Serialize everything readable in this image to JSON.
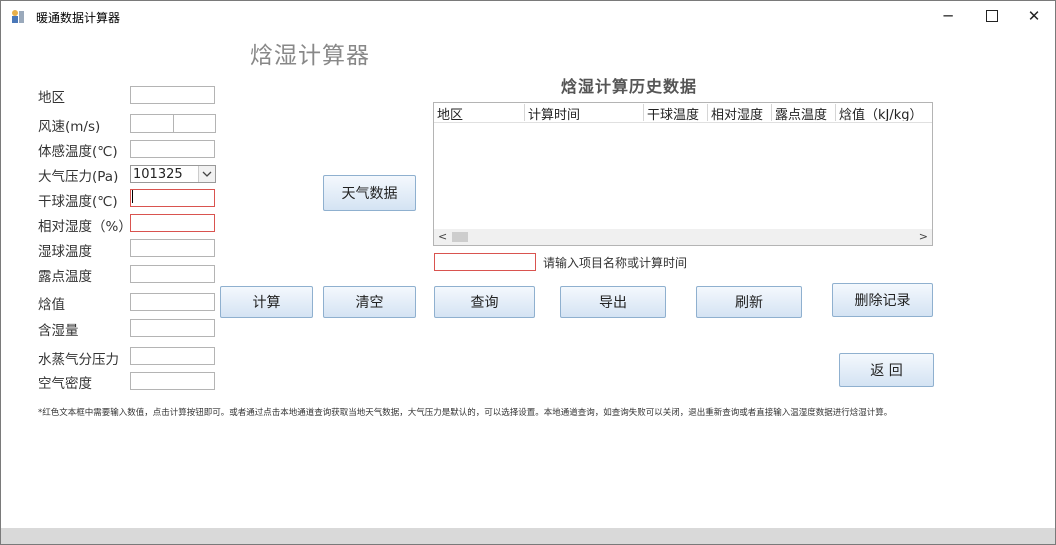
{
  "window": {
    "title": "暖通数据计算器",
    "controls": {
      "minimize": "─",
      "close": "✕"
    }
  },
  "main": {
    "heading": "焓湿计算器",
    "fields": {
      "region": {
        "label": "地区",
        "value": ""
      },
      "wind_speed": {
        "label": "风速(m/s)",
        "value": ""
      },
      "feels_like": {
        "label": "体感温度(℃)",
        "value": ""
      },
      "pressure": {
        "label": "大气压力(Pa)",
        "value": "101325"
      },
      "dry_bulb": {
        "label": "干球温度(℃)",
        "value": ""
      },
      "rel_humidity": {
        "label": "相对湿度（%）",
        "value": ""
      },
      "wet_bulb": {
        "label": "湿球温度",
        "value": ""
      },
      "dew_point": {
        "label": "露点温度",
        "value": ""
      },
      "enthalpy": {
        "label": "焓值",
        "value": ""
      },
      "moisture": {
        "label": "含湿量",
        "value": ""
      },
      "vapor_pressure": {
        "label": "水蒸气分压力",
        "value": ""
      },
      "air_density": {
        "label": "空气密度",
        "value": ""
      }
    },
    "buttons": {
      "weather": "天气数据",
      "calculate": "计算",
      "clear": "清空",
      "query": "查询",
      "export": "导出",
      "refresh": "刷新",
      "delete": "删除记录",
      "back": "返 回"
    },
    "history": {
      "title": "焓湿计算历史数据",
      "columns": [
        "地区",
        "计算时间",
        "干球温度",
        "相对湿度",
        "露点温度",
        "焓值（kJ/kg）"
      ],
      "rows": []
    },
    "search": {
      "value": "",
      "hint": "请输入项目名称或计算时间"
    },
    "note": "*红色文本框中需要输入数值，点击计算按钮即可。或者通过点击本地通道查询获取当地天气数据，大气压力是默认的，可以选择设置。本地通道查询，如查询失败可以关闭，退出重新查询或者直接输入温湿度数据进行焓湿计算。"
  },
  "colors": {
    "accent_border": "#d9534f",
    "button_top": "#f4f8fd",
    "button_bottom": "#d4e3f3"
  }
}
